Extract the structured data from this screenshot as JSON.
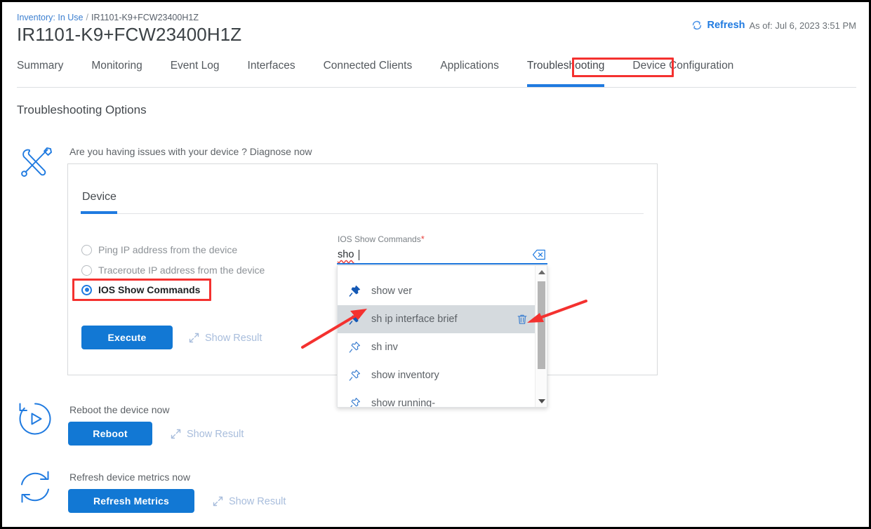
{
  "breadcrumb": {
    "link": "Inventory: In Use",
    "separator": "/",
    "current": "IR1101-K9+FCW23400H1Z"
  },
  "header": {
    "title": "IR1101-K9+FCW23400H1Z",
    "refresh_label": "Refresh",
    "refresh_icon": "refresh-circular-arrow-icon",
    "as_of": "As of: Jul 6, 2023 3:51 PM"
  },
  "tabs": [
    {
      "label": "Summary",
      "active": false
    },
    {
      "label": "Monitoring",
      "active": false
    },
    {
      "label": "Event Log",
      "active": false
    },
    {
      "label": "Interfaces",
      "active": false
    },
    {
      "label": "Connected Clients",
      "active": false
    },
    {
      "label": "Applications",
      "active": false
    },
    {
      "label": "Troubleshooting",
      "active": true
    },
    {
      "label": "Device Configuration",
      "active": false
    }
  ],
  "section": {
    "title": "Troubleshooting Options"
  },
  "diagnose": {
    "icon": "wrench-screwdriver-icon",
    "prompt": "Are you having issues with your device ? Diagnose now",
    "card_tab": "Device",
    "radios": [
      {
        "label": "Ping IP address from the device",
        "selected": false
      },
      {
        "label": "Traceroute IP address from the device",
        "selected": false
      },
      {
        "label": "IOS Show Commands",
        "selected": true
      }
    ],
    "execute_label": "Execute",
    "show_result_label": "Show Result",
    "show_result_icon": "expand-diagonal-arrow-icon"
  },
  "command_field": {
    "label": "IOS Show Commands",
    "required_marker": "*",
    "value": "sho",
    "clear_icon": "backspace-clear-icon"
  },
  "dropdown": {
    "items": [
      {
        "name": "show ver",
        "pinned": true,
        "highlighted": false,
        "icon": "pushpin-filled-icon"
      },
      {
        "name": "sh ip interface brief",
        "pinned": true,
        "highlighted": true,
        "icon": "pushpin-filled-icon",
        "delete_icon": "trash-icon"
      },
      {
        "name": "sh inv",
        "pinned": false,
        "highlighted": false,
        "icon": "pushpin-outline-icon"
      },
      {
        "name": "show inventory",
        "pinned": false,
        "highlighted": false,
        "icon": "pushpin-outline-icon"
      },
      {
        "name": "show running-",
        "pinned": false,
        "highlighted": false,
        "icon": "pushpin-outline-icon"
      }
    ],
    "scrollbar": {
      "up_icon": "scroll-up-arrow-icon",
      "down_icon": "scroll-down-arrow-icon"
    }
  },
  "reboot": {
    "icon": "reboot-play-circle-icon",
    "text": "Reboot the device now",
    "button_label": "Reboot",
    "show_result_label": "Show Result",
    "show_result_icon": "expand-diagonal-arrow-icon"
  },
  "refresh_metrics": {
    "icon": "refresh-circle-icon",
    "text": "Refresh device metrics now",
    "button_label": "Refresh Metrics",
    "show_result_label": "Show Result",
    "show_result_icon": "expand-diagonal-arrow-icon"
  },
  "colors": {
    "accent_blue": "#1278d4",
    "link_blue": "#1f7ae0",
    "annotation_red": "#f4312f",
    "highlight_grey": "#d5dade"
  }
}
